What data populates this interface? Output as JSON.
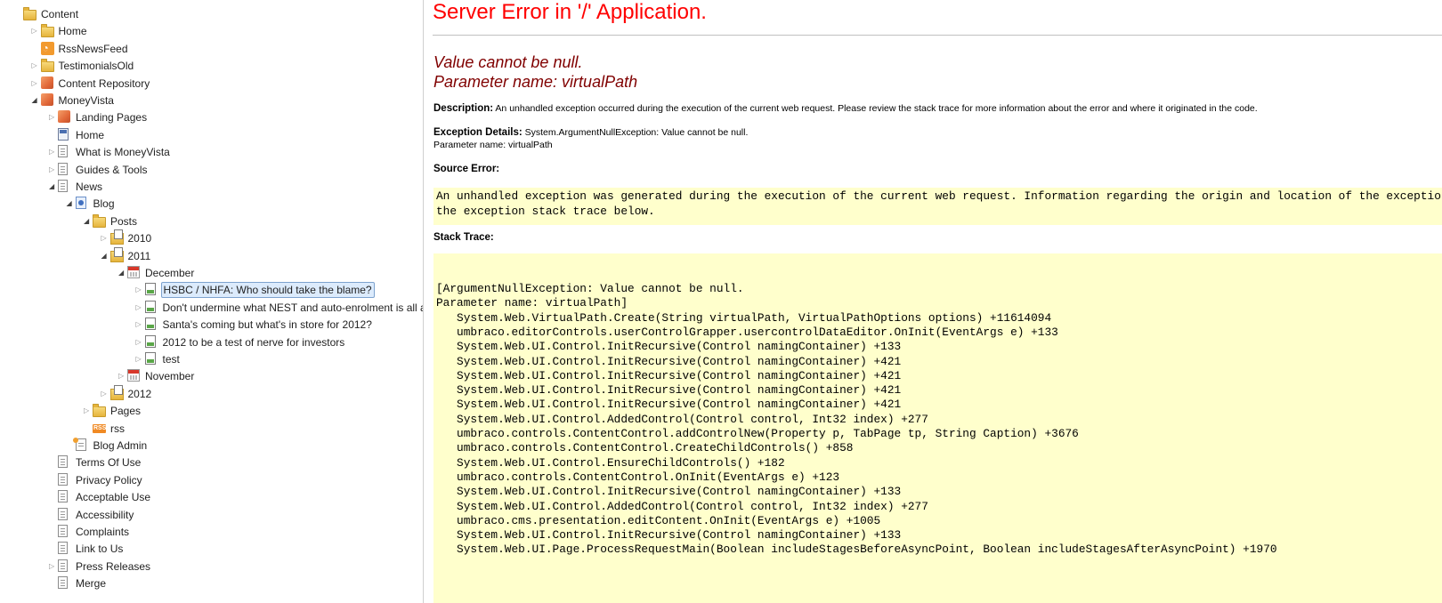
{
  "tree": {
    "items": [
      {
        "label": "Content",
        "icon": "folder-icon",
        "depth": 0,
        "state": "none"
      },
      {
        "label": "Home",
        "icon": "folder-icon",
        "depth": 1,
        "state": "collapsed"
      },
      {
        "label": "RssNewsFeed",
        "icon": "rss-icon",
        "depth": 1,
        "state": "none"
      },
      {
        "label": "TestimonialsOld",
        "icon": "folder-icon",
        "depth": 1,
        "state": "collapsed"
      },
      {
        "label": "Content Repository",
        "icon": "box-icon",
        "depth": 1,
        "state": "collapsed"
      },
      {
        "label": "MoneyVista",
        "icon": "box-icon",
        "depth": 1,
        "state": "expanded"
      },
      {
        "label": "Landing Pages",
        "icon": "box-icon",
        "depth": 2,
        "state": "collapsed"
      },
      {
        "label": "Home",
        "icon": "home-page-icon",
        "depth": 2,
        "state": "none"
      },
      {
        "label": "What is MoneyVista",
        "icon": "document-icon",
        "depth": 2,
        "state": "collapsed"
      },
      {
        "label": "Guides & Tools",
        "icon": "document-icon",
        "depth": 2,
        "state": "collapsed"
      },
      {
        "label": "News",
        "icon": "document-icon",
        "depth": 2,
        "state": "expanded"
      },
      {
        "label": "Blog",
        "icon": "blog-icon",
        "depth": 3,
        "state": "expanded"
      },
      {
        "label": "Posts",
        "icon": "folder-icon",
        "depth": 4,
        "state": "expanded"
      },
      {
        "label": "2010",
        "icon": "folder-stack-icon",
        "depth": 5,
        "state": "collapsed"
      },
      {
        "label": "2011",
        "icon": "folder-stack-icon",
        "depth": 5,
        "state": "expanded"
      },
      {
        "label": "December",
        "icon": "calendar-icon",
        "depth": 6,
        "state": "expanded"
      },
      {
        "label": "HSBC / NHFA: Who should take the blame?",
        "icon": "post-icon",
        "depth": 7,
        "state": "collapsed",
        "selected": true
      },
      {
        "label": "Don't undermine what NEST and auto-enrolment is all about",
        "icon": "post-icon",
        "depth": 7,
        "state": "collapsed"
      },
      {
        "label": "Santa's coming but what's in store for 2012?",
        "icon": "post-icon",
        "depth": 7,
        "state": "collapsed"
      },
      {
        "label": "2012 to be a test of nerve for investors",
        "icon": "post-icon",
        "depth": 7,
        "state": "collapsed"
      },
      {
        "label": "test",
        "icon": "post-icon",
        "depth": 7,
        "state": "collapsed"
      },
      {
        "label": "November",
        "icon": "calendar-icon",
        "depth": 6,
        "state": "collapsed"
      },
      {
        "label": "2012",
        "icon": "folder-stack-icon",
        "depth": 5,
        "state": "collapsed"
      },
      {
        "label": "Pages",
        "icon": "folder-icon",
        "depth": 4,
        "state": "collapsed"
      },
      {
        "label": "rss",
        "icon": "rss-badge-icon",
        "depth": 4,
        "state": "none"
      },
      {
        "label": "Blog Admin",
        "icon": "blog-admin-icon",
        "depth": 3,
        "state": "none"
      },
      {
        "label": "Terms Of Use",
        "icon": "document-icon",
        "depth": 2,
        "state": "none"
      },
      {
        "label": "Privacy Policy",
        "icon": "document-icon",
        "depth": 2,
        "state": "none"
      },
      {
        "label": "Acceptable Use",
        "icon": "document-icon",
        "depth": 2,
        "state": "none"
      },
      {
        "label": "Accessibility",
        "icon": "document-icon",
        "depth": 2,
        "state": "none"
      },
      {
        "label": "Complaints",
        "icon": "document-icon",
        "depth": 2,
        "state": "none"
      },
      {
        "label": "Link to Us",
        "icon": "document-icon",
        "depth": 2,
        "state": "none"
      },
      {
        "label": "Press Releases",
        "icon": "document-icon",
        "depth": 2,
        "state": "collapsed"
      },
      {
        "label": "Merge",
        "icon": "document-icon",
        "depth": 2,
        "state": "none"
      }
    ]
  },
  "error": {
    "title": "Server Error in '/' Application.",
    "message_line1": "Value cannot be null.",
    "message_line2": "Parameter name: virtualPath",
    "description_label": "Description:",
    "description_text": " An unhandled exception occurred during the execution of the current web request. Please review the stack trace for more information about the error and where it originated in the code.",
    "exception_label": "Exception Details:",
    "exception_text": " System.ArgumentNullException: Value cannot be null.",
    "exception_line2": "Parameter name: virtualPath",
    "source_label": "Source Error:",
    "source_text": "An unhandled exception was generated during the execution of the current web request. Information regarding the origin and location of the exception can be identified using\nthe exception stack trace below.",
    "stack_label": "Stack Trace:",
    "stack_lines": [
      "[ArgumentNullException: Value cannot be null.",
      "Parameter name: virtualPath]",
      "   System.Web.VirtualPath.Create(String virtualPath, VirtualPathOptions options) +11614094",
      "   umbraco.editorControls.userControlGrapper.usercontrolDataEditor.OnInit(EventArgs e) +133",
      "   System.Web.UI.Control.InitRecursive(Control namingContainer) +133",
      "   System.Web.UI.Control.InitRecursive(Control namingContainer) +421",
      "   System.Web.UI.Control.InitRecursive(Control namingContainer) +421",
      "   System.Web.UI.Control.InitRecursive(Control namingContainer) +421",
      "   System.Web.UI.Control.InitRecursive(Control namingContainer) +421",
      "   System.Web.UI.Control.AddedControl(Control control, Int32 index) +277",
      "   umbraco.controls.ContentControl.addControlNew(Property p, TabPage tp, String Caption) +3676",
      "   umbraco.controls.ContentControl.CreateChildControls() +858",
      "   System.Web.UI.Control.EnsureChildControls() +182",
      "   umbraco.controls.ContentControl.OnInit(EventArgs e) +123",
      "   System.Web.UI.Control.InitRecursive(Control namingContainer) +133",
      "   System.Web.UI.Control.AddedControl(Control control, Int32 index) +277",
      "   umbraco.cms.presentation.editContent.OnInit(EventArgs e) +1005",
      "   System.Web.UI.Control.InitRecursive(Control namingContainer) +133",
      "   System.Web.UI.Page.ProcessRequestMain(Boolean includeStagesBeforeAsyncPoint, Boolean includeStagesAfterAsyncPoint) +1970"
    ]
  }
}
